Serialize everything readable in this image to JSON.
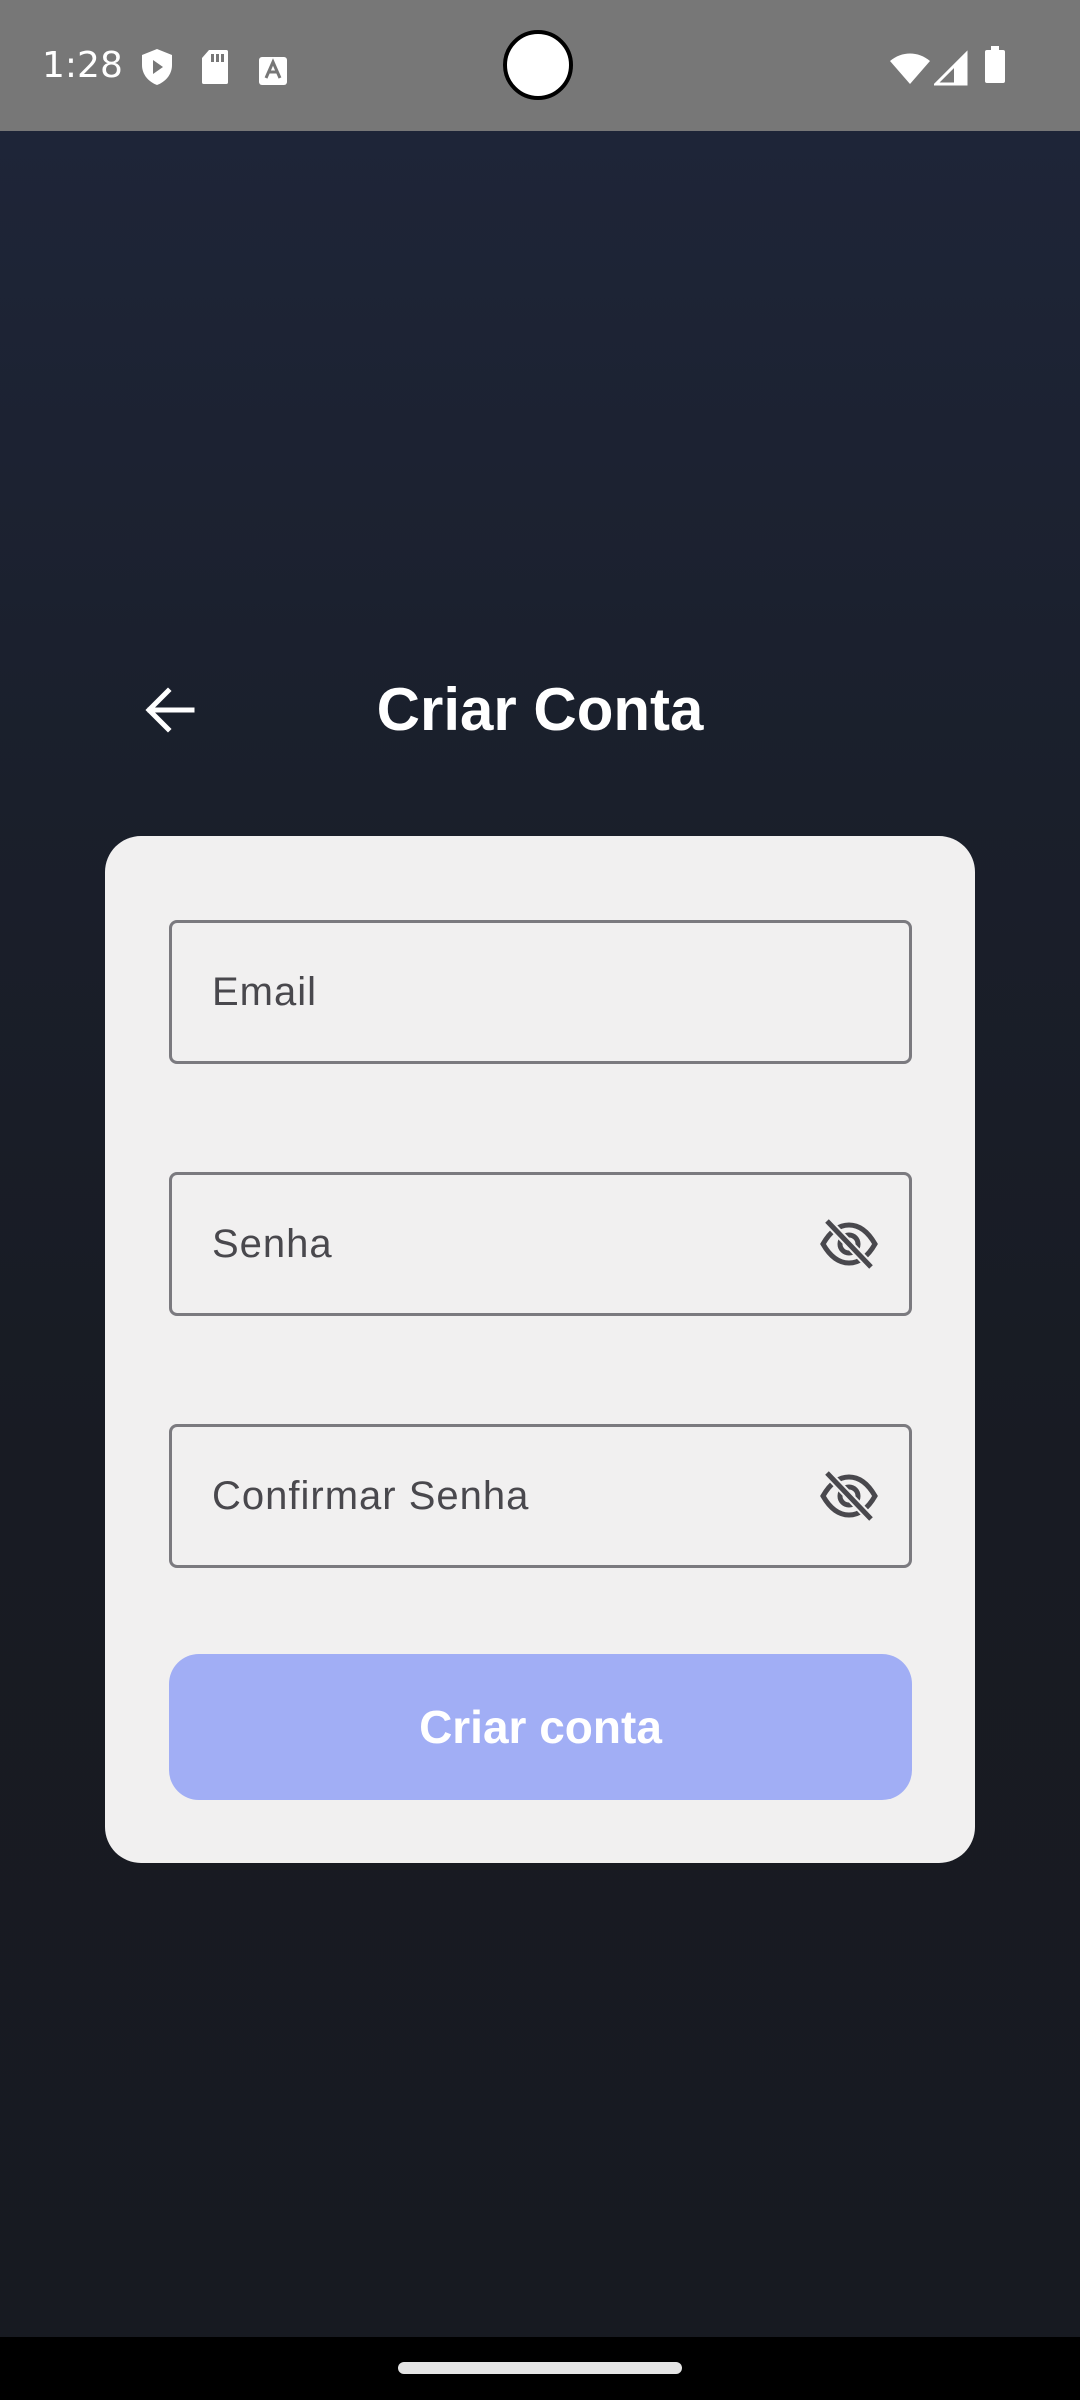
{
  "status_bar": {
    "time": "1:28",
    "icons": [
      "shield-icon",
      "sd-card-icon",
      "text-a-icon",
      "wifi-icon",
      "signal-icon",
      "battery-icon"
    ]
  },
  "header": {
    "back_icon": "arrow-left-icon",
    "title": "Criar Conta"
  },
  "form": {
    "email_label": "Email",
    "password_label": "Senha",
    "confirm_password_label": "Confirmar Senha",
    "visibility_icon": "eye-off-icon",
    "submit_label": "Criar conta"
  },
  "colors": {
    "status_bar": "#777777",
    "background": "#181b23",
    "card": "#f1f0f0",
    "button": "#a1aef5",
    "field_border": "#7b7a7f",
    "label_text": "#49484d"
  }
}
